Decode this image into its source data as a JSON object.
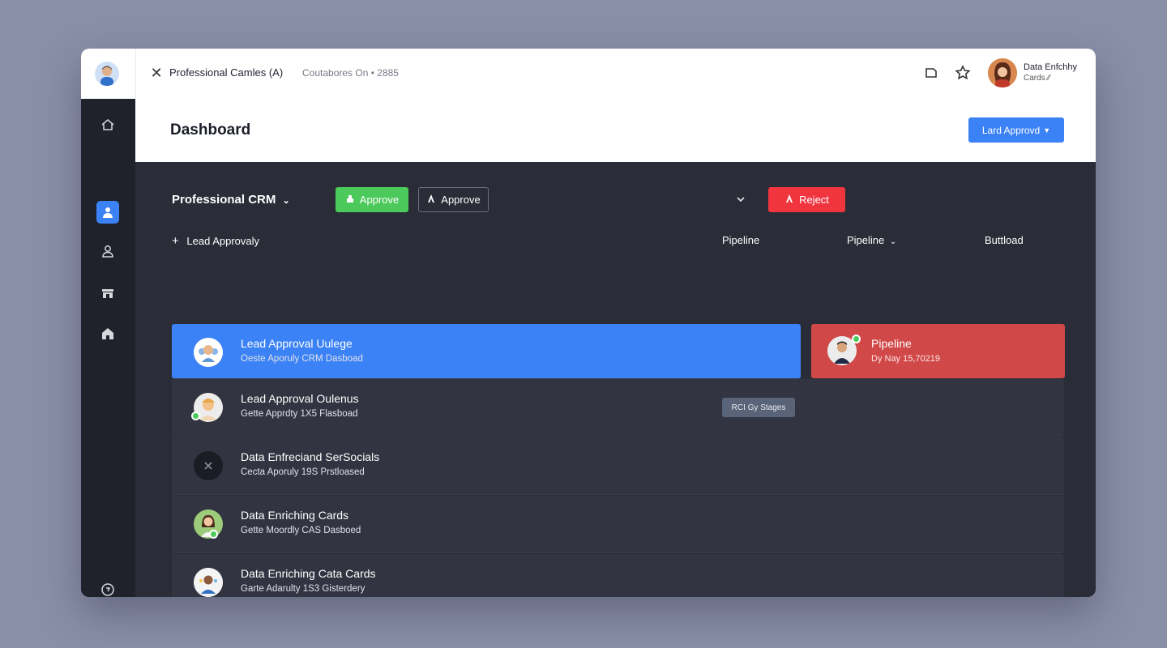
{
  "topbar": {
    "tab_title": "Professional Camles (A)",
    "tab_subtitle": "Coutabores On  •  2885",
    "user_name": "Data Enfchhy",
    "user_sub": "Cards ⁄⁄"
  },
  "header": {
    "title": "Dashboard",
    "button_label": "Lard Approvd"
  },
  "toolbar": {
    "crm_select": "Professional CRM",
    "approve_primary": "Approve",
    "approve_secondary": "Approve",
    "reject": "Reject"
  },
  "list_header": {
    "add_label": "Lead Approvaly",
    "col_pipeline_1": "Pipeline",
    "col_pipeline_2": "Pipeline",
    "col_buttoad": "Buttload"
  },
  "rows": [
    {
      "title": "Lead Approval Uulege",
      "subtitle": "Oeste Aporuly CRM Dasboad"
    },
    {
      "title": "Lead Approval Oulenus",
      "subtitle": "Gette Apprdty 1X5 Flasboad",
      "badge": "RCI Gy Stages"
    },
    {
      "title": "Data Enfreciand SerSocials",
      "subtitle": "Cecta Aporuly 19S Prstloased"
    },
    {
      "title": "Data Enriching Cards",
      "subtitle": "Gette Moordly CAS Dasboed"
    },
    {
      "title": "Data Enriching Cata Cards",
      "subtitle": "Garte Adarulty 1S3 Gisterdery"
    }
  ],
  "pipeline_card": {
    "title": "Pipeline",
    "subtitle": "Dy Nay 15,70219"
  },
  "colors": {
    "accent_blue": "#3b82f6",
    "approve_green": "#4bc95b",
    "reject_red": "#f0353f",
    "pipeline_red": "#d14848",
    "sidebar": "#1f222b",
    "content_bg": "#2a2d38"
  }
}
